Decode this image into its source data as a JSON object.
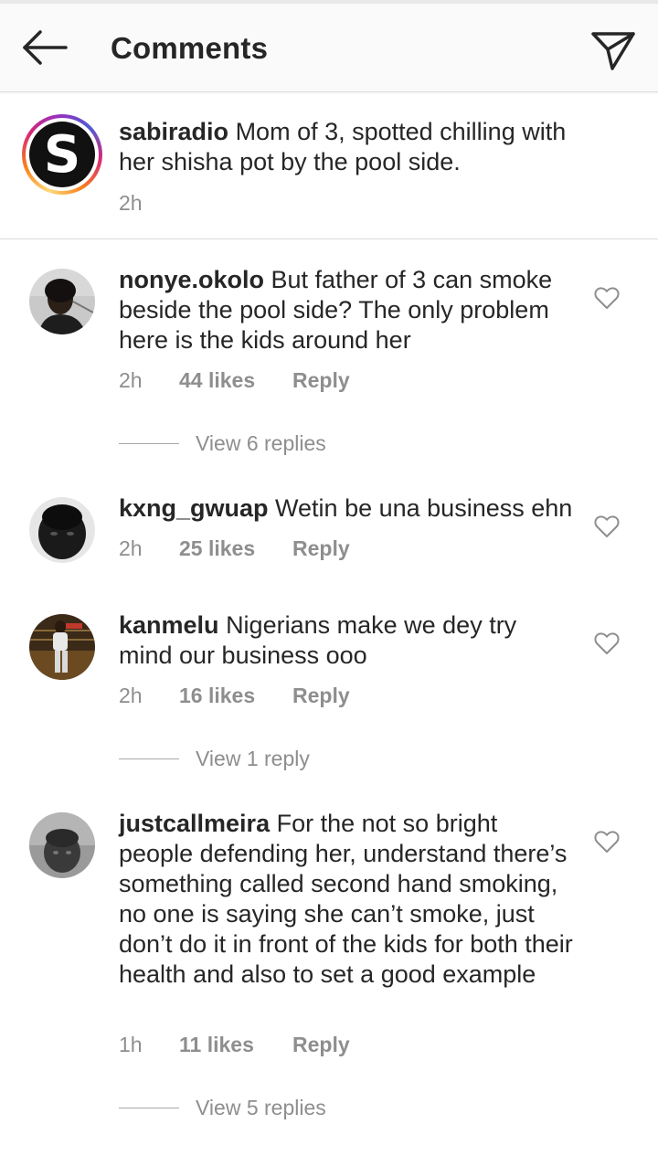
{
  "header": {
    "title": "Comments"
  },
  "caption": {
    "username": "sabiradio",
    "text": "Mom of 3, spotted chilling with her shisha pot by the pool side.",
    "time": "2h",
    "avatar_letter": "S"
  },
  "comments": [
    {
      "username": "nonye.okolo",
      "text": "But father of 3 can smoke beside the pool side? The only problem here is the kids around her",
      "time": "2h",
      "likes": "44 likes",
      "reply": "Reply",
      "view_replies": "View 6 replies"
    },
    {
      "username": "kxng_gwuap",
      "text": "Wetin be una business ehn",
      "time": "2h",
      "likes": "25 likes",
      "reply": "Reply"
    },
    {
      "username": "kanmelu",
      "text": "Nigerians make we dey try mind our business ooo",
      "time": "2h",
      "likes": "16 likes",
      "reply": "Reply",
      "view_replies": "View 1 reply"
    },
    {
      "username": "justcallmeira",
      "text": "For the not so bright people defending her, understand there’s something called second hand smoking, no one is saying she can’t smoke, just don’t do it in front of the kids for both their health and also to set a good example",
      "time": "1h",
      "likes": "11 likes",
      "reply": "Reply",
      "view_replies": "View 5 replies"
    }
  ],
  "icons": {
    "back": "arrow-left-icon",
    "send": "direct-send-icon",
    "like": "heart-outline-icon"
  },
  "colors": {
    "text": "#262626",
    "muted": "#8e8e8e",
    "divider": "#dbdbdb"
  }
}
